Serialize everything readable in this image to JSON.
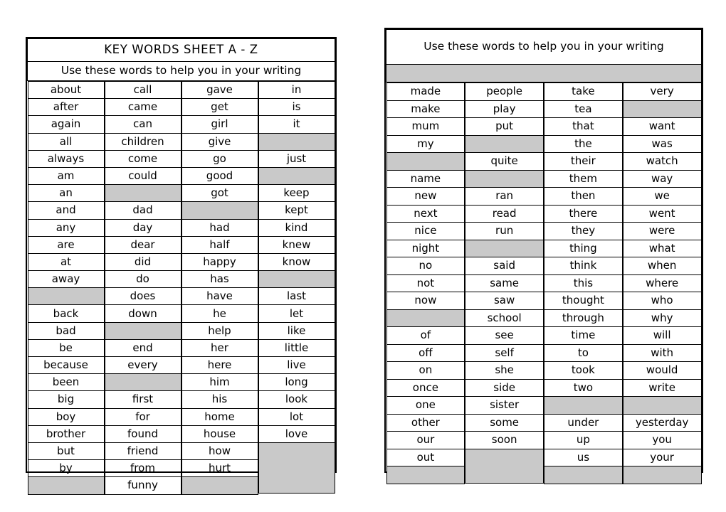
{
  "page": {
    "background_color": "#ffffff",
    "gray_cell_color": "#c9c9c9",
    "border_color": "#000000"
  },
  "left_sheet": {
    "title": "KEY WORDS SHEET A - Z",
    "subtitle": "Use these words to help you in your writing",
    "row_count": 24,
    "columns": [
      {
        "index": 1,
        "cells": [
          {
            "text": "about",
            "gray": false
          },
          {
            "text": "after",
            "gray": false
          },
          {
            "text": "again",
            "gray": false
          },
          {
            "text": "all",
            "gray": false
          },
          {
            "text": "always",
            "gray": false
          },
          {
            "text": "am",
            "gray": false
          },
          {
            "text": "an",
            "gray": false
          },
          {
            "text": "and",
            "gray": false
          },
          {
            "text": "any",
            "gray": false
          },
          {
            "text": "are",
            "gray": false
          },
          {
            "text": "at",
            "gray": false
          },
          {
            "text": "away",
            "gray": false
          },
          {
            "text": "",
            "gray": true
          },
          {
            "text": "back",
            "gray": false
          },
          {
            "text": "bad",
            "gray": false
          },
          {
            "text": "be",
            "gray": false
          },
          {
            "text": "because",
            "gray": false
          },
          {
            "text": "been",
            "gray": false
          },
          {
            "text": "big",
            "gray": false
          },
          {
            "text": "boy",
            "gray": false
          },
          {
            "text": "brother",
            "gray": false
          },
          {
            "text": "but",
            "gray": false
          },
          {
            "text": "by",
            "gray": false
          },
          {
            "text": "",
            "gray": true
          }
        ]
      },
      {
        "index": 2,
        "cells": [
          {
            "text": "call",
            "gray": false
          },
          {
            "text": "came",
            "gray": false
          },
          {
            "text": "can",
            "gray": false
          },
          {
            "text": "children",
            "gray": false
          },
          {
            "text": "come",
            "gray": false
          },
          {
            "text": "could",
            "gray": false
          },
          {
            "text": "",
            "gray": true
          },
          {
            "text": "dad",
            "gray": false
          },
          {
            "text": "day",
            "gray": false
          },
          {
            "text": "dear",
            "gray": false
          },
          {
            "text": "did",
            "gray": false
          },
          {
            "text": "do",
            "gray": false
          },
          {
            "text": "does",
            "gray": false
          },
          {
            "text": "down",
            "gray": false
          },
          {
            "text": "",
            "gray": true
          },
          {
            "text": "end",
            "gray": false
          },
          {
            "text": "every",
            "gray": false
          },
          {
            "text": "",
            "gray": true
          },
          {
            "text": "first",
            "gray": false
          },
          {
            "text": "for",
            "gray": false
          },
          {
            "text": "found",
            "gray": false
          },
          {
            "text": "friend",
            "gray": false
          },
          {
            "text": "from",
            "gray": false
          },
          {
            "text": "funny",
            "gray": false
          }
        ]
      },
      {
        "index": 3,
        "cells": [
          {
            "text": "gave",
            "gray": false
          },
          {
            "text": "get",
            "gray": false
          },
          {
            "text": "girl",
            "gray": false
          },
          {
            "text": "give",
            "gray": false
          },
          {
            "text": "go",
            "gray": false
          },
          {
            "text": "good",
            "gray": false
          },
          {
            "text": "got",
            "gray": false
          },
          {
            "text": "",
            "gray": true
          },
          {
            "text": "had",
            "gray": false
          },
          {
            "text": "half",
            "gray": false
          },
          {
            "text": "happy",
            "gray": false
          },
          {
            "text": "has",
            "gray": false
          },
          {
            "text": "have",
            "gray": false
          },
          {
            "text": "he",
            "gray": false
          },
          {
            "text": "help",
            "gray": false
          },
          {
            "text": "her",
            "gray": false
          },
          {
            "text": "here",
            "gray": false
          },
          {
            "text": "him",
            "gray": false
          },
          {
            "text": "his",
            "gray": false
          },
          {
            "text": "home",
            "gray": false
          },
          {
            "text": "house",
            "gray": false
          },
          {
            "text": "how",
            "gray": false
          },
          {
            "text": "hurt",
            "gray": false
          },
          {
            "text": "",
            "gray": true
          }
        ]
      },
      {
        "index": 4,
        "cells": [
          {
            "text": "in",
            "gray": false
          },
          {
            "text": "is",
            "gray": false
          },
          {
            "text": "it",
            "gray": false
          },
          {
            "text": "",
            "gray": true
          },
          {
            "text": "just",
            "gray": false
          },
          {
            "text": "",
            "gray": true
          },
          {
            "text": "keep",
            "gray": false
          },
          {
            "text": "kept",
            "gray": false
          },
          {
            "text": "kind",
            "gray": false
          },
          {
            "text": "knew",
            "gray": false
          },
          {
            "text": "know",
            "gray": false
          },
          {
            "text": "",
            "gray": true
          },
          {
            "text": "last",
            "gray": false
          },
          {
            "text": "let",
            "gray": false
          },
          {
            "text": "like",
            "gray": false
          },
          {
            "text": "little",
            "gray": false
          },
          {
            "text": "live",
            "gray": false
          },
          {
            "text": "long",
            "gray": false
          },
          {
            "text": "look",
            "gray": false
          },
          {
            "text": "lot",
            "gray": false
          },
          {
            "text": "love",
            "gray": false
          },
          {
            "text": "",
            "gray": true,
            "span": 3
          }
        ]
      }
    ]
  },
  "right_sheet": {
    "subtitle": "Use these words to help you in your writing",
    "row_count": 23,
    "has_top_band": true,
    "columns": [
      {
        "index": 1,
        "cells": [
          {
            "text": "made",
            "gray": false
          },
          {
            "text": "make",
            "gray": false
          },
          {
            "text": "mum",
            "gray": false
          },
          {
            "text": "my",
            "gray": false
          },
          {
            "text": "",
            "gray": true
          },
          {
            "text": "name",
            "gray": false
          },
          {
            "text": "new",
            "gray": false
          },
          {
            "text": "next",
            "gray": false
          },
          {
            "text": "nice",
            "gray": false
          },
          {
            "text": "night",
            "gray": false
          },
          {
            "text": "no",
            "gray": false
          },
          {
            "text": "not",
            "gray": false
          },
          {
            "text": "now",
            "gray": false
          },
          {
            "text": "",
            "gray": true
          },
          {
            "text": "of",
            "gray": false
          },
          {
            "text": "off",
            "gray": false
          },
          {
            "text": "on",
            "gray": false
          },
          {
            "text": "once",
            "gray": false
          },
          {
            "text": "one",
            "gray": false
          },
          {
            "text": "other",
            "gray": false
          },
          {
            "text": "our",
            "gray": false
          },
          {
            "text": "out",
            "gray": false
          },
          {
            "text": "",
            "gray": true
          }
        ]
      },
      {
        "index": 2,
        "cells": [
          {
            "text": "people",
            "gray": false
          },
          {
            "text": "play",
            "gray": false
          },
          {
            "text": "put",
            "gray": false
          },
          {
            "text": "",
            "gray": true
          },
          {
            "text": "quite",
            "gray": false
          },
          {
            "text": "",
            "gray": true
          },
          {
            "text": "ran",
            "gray": false
          },
          {
            "text": "read",
            "gray": false
          },
          {
            "text": "run",
            "gray": false
          },
          {
            "text": "",
            "gray": true
          },
          {
            "text": "said",
            "gray": false
          },
          {
            "text": "same",
            "gray": false
          },
          {
            "text": "saw",
            "gray": false
          },
          {
            "text": "school",
            "gray": false
          },
          {
            "text": "see",
            "gray": false
          },
          {
            "text": "self",
            "gray": false
          },
          {
            "text": "she",
            "gray": false
          },
          {
            "text": "side",
            "gray": false
          },
          {
            "text": "sister",
            "gray": false
          },
          {
            "text": "some",
            "gray": false
          },
          {
            "text": "soon",
            "gray": false
          },
          {
            "text": "",
            "gray": true,
            "span": 2
          }
        ]
      },
      {
        "index": 3,
        "cells": [
          {
            "text": "take",
            "gray": false
          },
          {
            "text": "tea",
            "gray": false
          },
          {
            "text": "that",
            "gray": false
          },
          {
            "text": "the",
            "gray": false
          },
          {
            "text": "their",
            "gray": false
          },
          {
            "text": "them",
            "gray": false
          },
          {
            "text": "then",
            "gray": false
          },
          {
            "text": "there",
            "gray": false
          },
          {
            "text": "they",
            "gray": false
          },
          {
            "text": "thing",
            "gray": false
          },
          {
            "text": "think",
            "gray": false
          },
          {
            "text": "this",
            "gray": false
          },
          {
            "text": "thought",
            "gray": false
          },
          {
            "text": "through",
            "gray": false
          },
          {
            "text": "time",
            "gray": false
          },
          {
            "text": "to",
            "gray": false
          },
          {
            "text": "took",
            "gray": false
          },
          {
            "text": "two",
            "gray": false
          },
          {
            "text": "",
            "gray": true
          },
          {
            "text": "under",
            "gray": false
          },
          {
            "text": "up",
            "gray": false
          },
          {
            "text": "us",
            "gray": false
          },
          {
            "text": "",
            "gray": true
          }
        ]
      },
      {
        "index": 4,
        "cells": [
          {
            "text": "very",
            "gray": false
          },
          {
            "text": "",
            "gray": true
          },
          {
            "text": "want",
            "gray": false
          },
          {
            "text": "was",
            "gray": false
          },
          {
            "text": "watch",
            "gray": false
          },
          {
            "text": "way",
            "gray": false
          },
          {
            "text": "we",
            "gray": false
          },
          {
            "text": "went",
            "gray": false
          },
          {
            "text": "were",
            "gray": false
          },
          {
            "text": "what",
            "gray": false
          },
          {
            "text": "when",
            "gray": false
          },
          {
            "text": "where",
            "gray": false
          },
          {
            "text": "who",
            "gray": false
          },
          {
            "text": "why",
            "gray": false
          },
          {
            "text": "will",
            "gray": false
          },
          {
            "text": "with",
            "gray": false
          },
          {
            "text": "would",
            "gray": false
          },
          {
            "text": "write",
            "gray": false
          },
          {
            "text": "",
            "gray": true
          },
          {
            "text": "yesterday",
            "gray": false
          },
          {
            "text": "you",
            "gray": false
          },
          {
            "text": "your",
            "gray": false
          },
          {
            "text": "",
            "gray": true
          }
        ]
      }
    ]
  }
}
